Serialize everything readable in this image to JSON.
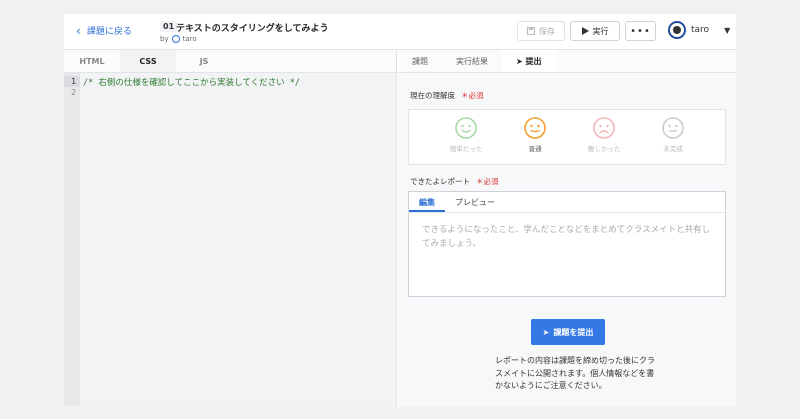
{
  "header": {
    "back_label": "課題に戻る",
    "lesson_number": "01",
    "lesson_title": "テキストのスタイリングをしてみよう",
    "by_label": "by",
    "author": "taro",
    "save_label": "保存",
    "run_label": "実行",
    "more_label": "•••",
    "user_name": "taro"
  },
  "editor": {
    "tabs": [
      "HTML",
      "CSS",
      "JS"
    ],
    "active_tab": "CSS",
    "line_numbers": [
      "1",
      "2"
    ],
    "code_line1": "/* 右側の仕様を確認してここから実装してください */"
  },
  "right": {
    "tabs": [
      "課題",
      "実行結果",
      "提出"
    ],
    "active_tab": "提出",
    "understanding_label": "現在の理解度",
    "required_label": "＊必須",
    "faces": [
      {
        "label": "簡単だった",
        "icon": "smile-icon",
        "color": "#a8d8a8"
      },
      {
        "label": "普通",
        "icon": "neutral-face-icon",
        "color": "#f0a030"
      },
      {
        "label": "難しかった",
        "icon": "frown-icon",
        "color": "#f5b5b5"
      },
      {
        "label": "未完成",
        "icon": "neutral-face-icon",
        "color": "#cccccc"
      }
    ],
    "selected_face": "普通",
    "report_label": "できたよレポート",
    "report_tabs": [
      "編集",
      "プレビュー"
    ],
    "report_placeholder": "できるようになったこと、学んだことなどをまとめてクラスメイトと共有してみましょう。",
    "submit_label": "課題を提出",
    "note": "レポートの内容は課題を締め切った後にクラスメイトに公開されます。個人情報などを書かないようにご注意ください。"
  },
  "colors": {
    "accent": "#3478e5",
    "required": "#dd3333",
    "code_comment": "#2c7a2c"
  }
}
